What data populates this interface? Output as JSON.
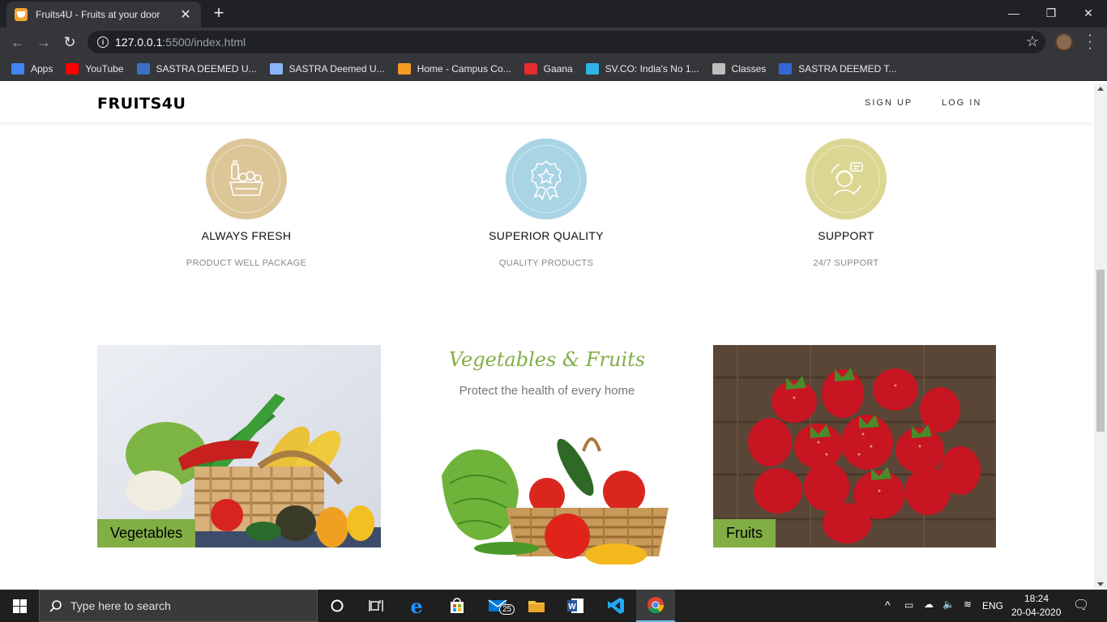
{
  "browser": {
    "tab_title": "Fruits4U - Fruits at your door",
    "url_host": "127.0.0.1",
    "url_path": ":5500/index.html",
    "bookmarks": [
      {
        "label": "Apps",
        "icon": "apps-grid-icon",
        "color": "#4285f4"
      },
      {
        "label": "YouTube",
        "icon": "youtube-icon",
        "color": "#ff0000"
      },
      {
        "label": "SASTRA DEEMED U...",
        "icon": "sastra-icon",
        "color": "#3a6fc4"
      },
      {
        "label": "SASTRA Deemed U...",
        "icon": "sastra-page-icon",
        "color": "#8ab4f8"
      },
      {
        "label": "Home - Campus Co...",
        "icon": "campus-icon",
        "color": "#f59a23"
      },
      {
        "label": "Gaana",
        "icon": "gaana-icon",
        "color": "#e72c30"
      },
      {
        "label": "SV.CO: India's No 1...",
        "icon": "svco-icon",
        "color": "#2db3e5"
      },
      {
        "label": "Classes",
        "icon": "classes-icon",
        "color": "#bdbdbd"
      },
      {
        "label": "SASTRA DEEMED T...",
        "icon": "calendar-icon",
        "color": "#3367d6"
      }
    ]
  },
  "site": {
    "brand": "FRUITS4U",
    "nav": {
      "signup": "SIGN UP",
      "login": "LOG IN"
    },
    "features": [
      {
        "title": "ALWAYS FRESH",
        "subtitle": "PRODUCT WELL PACKAGE",
        "color": "#dcc698",
        "icon": "fresh-produce-icon"
      },
      {
        "title": "SUPERIOR QUALITY",
        "subtitle": "QUALITY PRODUCTS",
        "color": "#a9d4e4",
        "icon": "quality-badge-icon"
      },
      {
        "title": "SUPPORT",
        "subtitle": "24/7 SUPPORT",
        "color": "#dbd692",
        "icon": "support-agent-icon"
      }
    ],
    "categories": {
      "left_label": "Vegetables",
      "right_label": "Fruits",
      "center_title": "Vegetables & Fruits",
      "center_subtitle": "Protect the health of every home"
    },
    "accent_color": "#82ae46"
  },
  "taskbar": {
    "search_placeholder": "Type here to search",
    "mail_badge": "25",
    "language": "ENG",
    "time": "18:24",
    "date": "20-04-2020"
  }
}
